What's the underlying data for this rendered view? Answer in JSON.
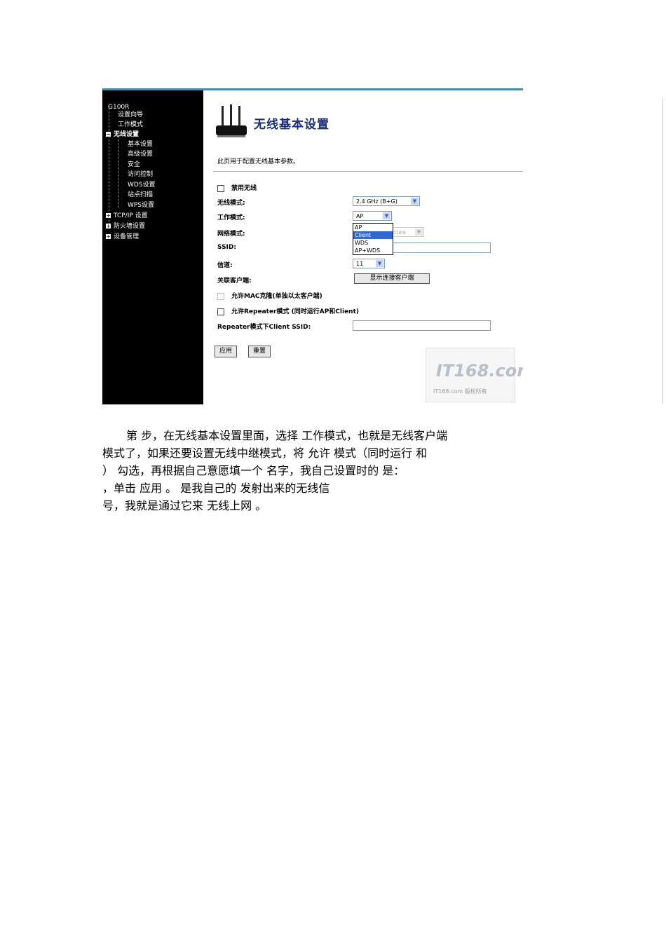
{
  "sidebar": {
    "device": "G100R",
    "items": [
      "设置向导",
      "工作模式",
      "无线设置",
      "基本设置",
      "高级设置",
      "安全",
      "访问控制",
      "WDS设置",
      "站点扫描",
      "WPS设置",
      "TCP/IP 设置",
      "防火墙设置",
      "设备管理"
    ]
  },
  "main": {
    "title": "无线基本设置",
    "description": "此页用于配置无线基本参数。",
    "disable_wireless": "禁用无线",
    "wireless_mode_label": "无线模式:",
    "wireless_mode_value": "2.4 GHz (B+G)",
    "work_mode_label": "工作模式:",
    "work_mode_value": "AP",
    "network_mode_label": "网络模式:",
    "network_mode_value": "cture",
    "ssid_label": "SSID:",
    "channel_label": "信道:",
    "channel_value": "11",
    "clients_label": "关联客户端:",
    "show_clients_button": "显示连接客户端",
    "mac_clone": "允许MAC克隆(单独以太客户端)",
    "repeater": "允许Repeater模式 (同时运行AP和Client)",
    "repeater_ssid_label": "Repeater模式下Client SSID:",
    "apply_button": "应用",
    "reset_button": "重置",
    "dropdown_options": [
      "AP",
      "Client",
      "WDS",
      "AP+WDS"
    ],
    "dropdown_selected": "Client"
  },
  "watermark": {
    "logo": "IT168.com",
    "subtitle": "IT168.com 版权所有"
  },
  "paragraph": {
    "line1": "第    步，在无线基本设置里面，选择                工作模式，也就是无线客户端",
    "line2": "模式了，如果还要设置无线中继模式，将  允许                 模式（同时运行      和",
    "line3": "              ）  勾选，再根据自己意愿填一个          名字，我自己设置时的            是：",
    "line4": "                  ，单击  应用   。                          是我自己的              发射出来的无线信",
    "line5": "号，我就是通过它来 无线上网 。"
  }
}
